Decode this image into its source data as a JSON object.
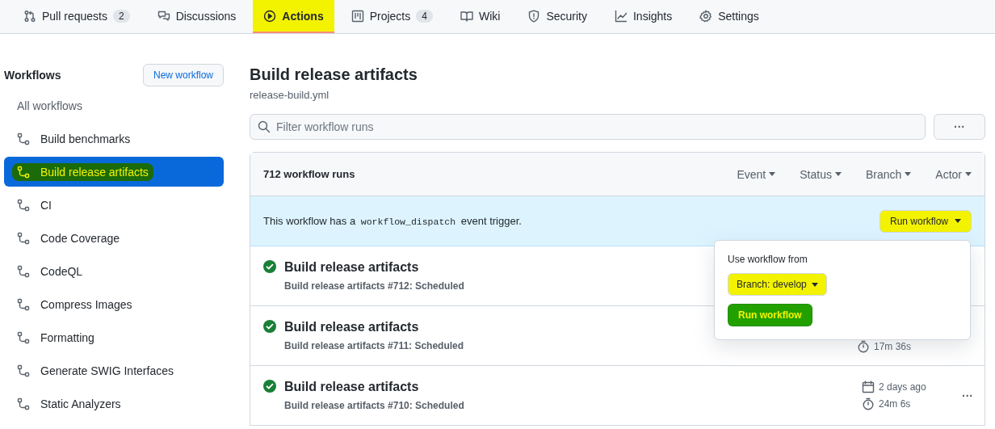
{
  "tabs": [
    {
      "label": "Pull requests",
      "counter": "2",
      "selected": false,
      "highlighted": false
    },
    {
      "label": "Discussions",
      "selected": false,
      "highlighted": false
    },
    {
      "label": "Actions",
      "selected": true,
      "highlighted": true
    },
    {
      "label": "Projects",
      "counter": "4",
      "selected": false,
      "highlighted": false
    },
    {
      "label": "Wiki",
      "selected": false,
      "highlighted": false
    },
    {
      "label": "Security",
      "selected": false,
      "highlighted": false
    },
    {
      "label": "Insights",
      "selected": false,
      "highlighted": false
    },
    {
      "label": "Settings",
      "selected": false,
      "highlighted": false
    }
  ],
  "sidebar": {
    "title": "Workflows",
    "new_button": "New workflow",
    "all_label": "All workflows",
    "items": [
      {
        "label": "Build benchmarks",
        "selected": false,
        "highlighted": false
      },
      {
        "label": "Build release artifacts",
        "selected": true,
        "highlighted": true
      },
      {
        "label": "CI",
        "selected": false,
        "highlighted": false
      },
      {
        "label": "Code Coverage",
        "selected": false,
        "highlighted": false
      },
      {
        "label": "CodeQL",
        "selected": false,
        "highlighted": false
      },
      {
        "label": "Compress Images",
        "selected": false,
        "highlighted": false
      },
      {
        "label": "Formatting",
        "selected": false,
        "highlighted": false
      },
      {
        "label": "Generate SWIG Interfaces",
        "selected": false,
        "highlighted": false
      },
      {
        "label": "Static Analyzers",
        "selected": false,
        "highlighted": false
      }
    ]
  },
  "workflow": {
    "title": "Build release artifacts",
    "file": "release-build.yml",
    "filter_placeholder": "Filter workflow runs",
    "more": "···"
  },
  "runs_box": {
    "count": "712 workflow runs",
    "filters": [
      "Event",
      "Status",
      "Branch",
      "Actor"
    ],
    "dispatch": {
      "before": "This workflow has a",
      "code": "workflow_dispatch",
      "after": "event trigger.",
      "button": "Run workflow",
      "highlighted": true
    },
    "runs": [
      {
        "title": "Build release artifacts",
        "subtitle": "Build release artifacts #712: Scheduled"
      },
      {
        "title": "Build release artifacts",
        "subtitle": "Build release artifacts #711: Scheduled",
        "duration": "17m 36s"
      },
      {
        "title": "Build release artifacts",
        "subtitle": "Build release artifacts #710: Scheduled",
        "date": "2 days ago",
        "duration": "24m 6s",
        "more": "···"
      }
    ]
  },
  "popover": {
    "label": "Use workflow from",
    "branch_button": "Branch: develop",
    "run_button": "Run workflow",
    "highlighted": true
  }
}
